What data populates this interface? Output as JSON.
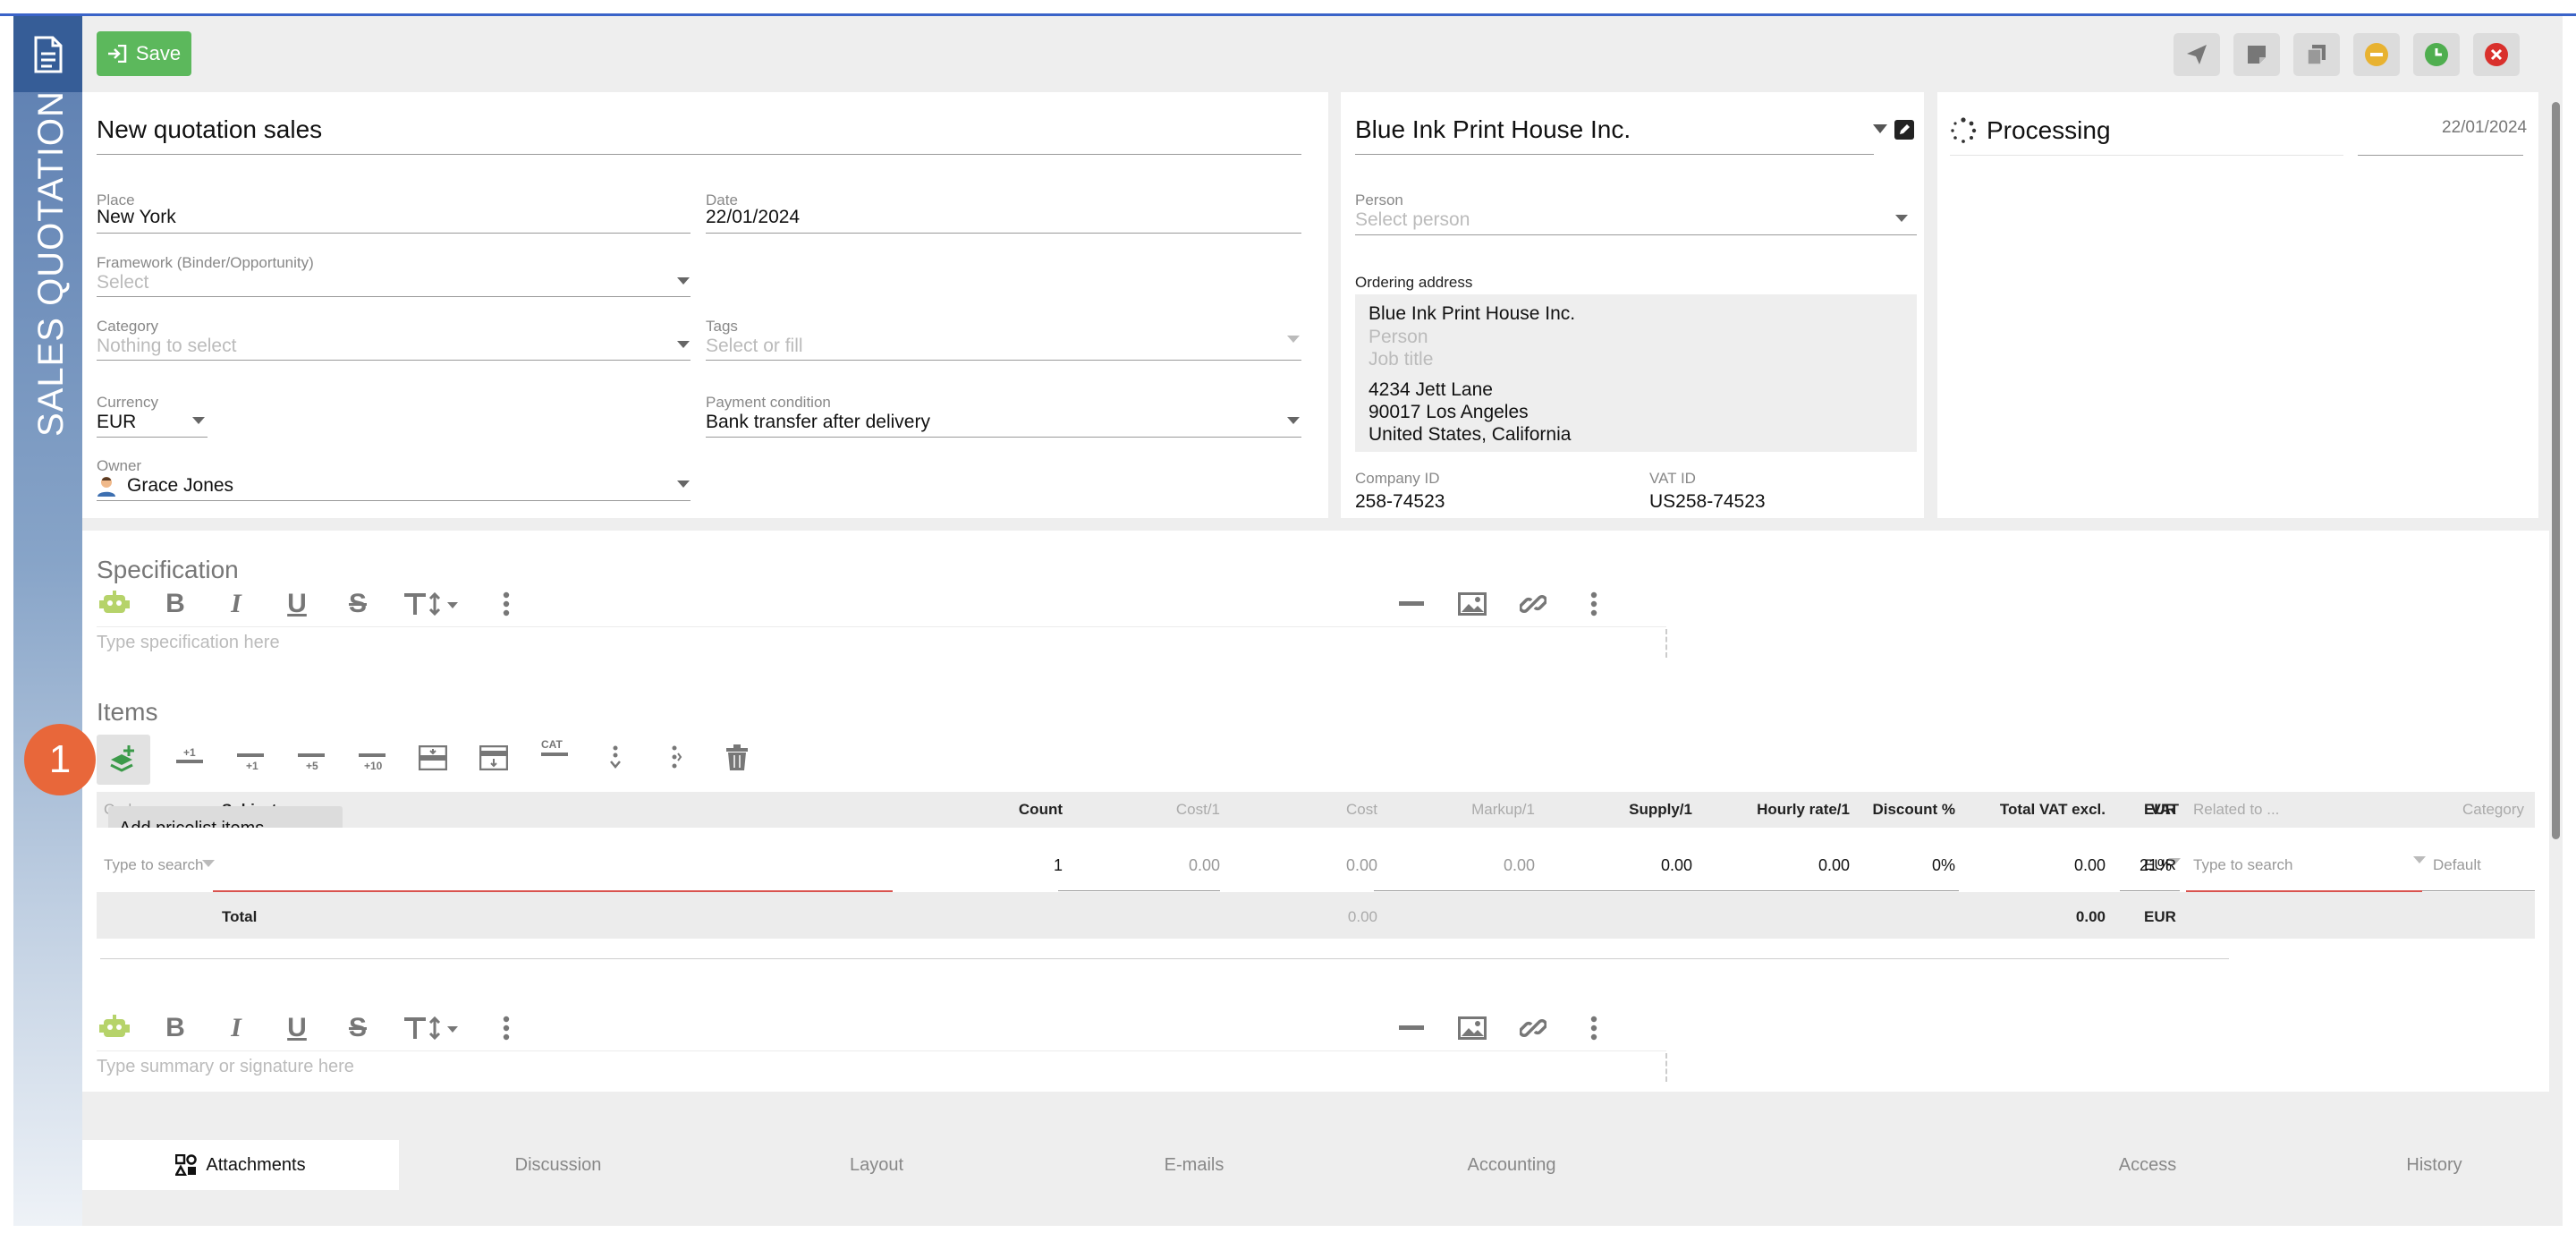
{
  "sidebar": {
    "title": "SALES QUOTATION"
  },
  "toolbar": {
    "save_label": "Save"
  },
  "header": {
    "title": "New quotation sales",
    "place_label": "Place",
    "place_value": "New York",
    "date_label": "Date",
    "date_value": "22/01/2024",
    "framework_label": "Framework (Binder/Opportunity)",
    "framework_placeholder": "Select",
    "category_label": "Category",
    "category_placeholder": "Nothing to select",
    "tags_label": "Tags",
    "tags_placeholder": "Select or fill",
    "currency_label": "Currency",
    "currency_value": "EUR",
    "payment_label": "Payment condition",
    "payment_value": "Bank transfer after delivery",
    "owner_label": "Owner",
    "owner_value": "Grace Jones"
  },
  "customer": {
    "company": "Blue Ink Print House Inc.",
    "person_label": "Person",
    "person_placeholder": "Select person",
    "address_label": "Ordering address",
    "address_company": "Blue Ink Print House Inc.",
    "address_person_ph": "Person",
    "address_job_ph": "Job title",
    "address_street": "4234 Jett Lane",
    "address_city": "90017 Los Angeles",
    "address_country": "United States, California",
    "company_id_label": "Company ID",
    "company_id_value": "258-74523",
    "vat_id_label": "VAT ID",
    "vat_id_value": "US258-74523"
  },
  "status": {
    "label": "Processing",
    "date": "22/01/2024"
  },
  "specification": {
    "title": "Specification",
    "placeholder": "Type specification here"
  },
  "items": {
    "title": "Items",
    "badge": "1",
    "tool_labels": {
      "plus1": "+1",
      "plus5": "+5",
      "plus10": "+10",
      "cat": "CAT"
    },
    "tooltip": "Add pricelist items",
    "columns": {
      "code": "Code",
      "subject": "Subject",
      "count": "Count",
      "cost_unit": "Cost/1",
      "cost": "Cost",
      "markup": "Markup/1",
      "supply": "Supply/1",
      "hourly": "Hourly rate/1",
      "discount": "Discount %",
      "total_vat_excl": "Total VAT excl.",
      "vat": "VAT",
      "currency": "EUR",
      "related": "Related to ...",
      "category": "Category"
    },
    "row": {
      "code_placeholder": "Type to search",
      "count": "1",
      "cost_unit": "0.00",
      "cost": "0.00",
      "markup": "0.00",
      "supply": "0.00",
      "hourly": "0.00",
      "discount": "0%",
      "total": "0.00",
      "vat": "21%",
      "currency": "EUR",
      "related_placeholder": "Type to search",
      "category_placeholder": "Default"
    },
    "totals": {
      "label": "Total",
      "cost": "0.00",
      "total": "0.00",
      "currency": "EUR"
    }
  },
  "summary": {
    "placeholder": "Type summary or signature here"
  },
  "tabs": [
    "Attachments",
    "Discussion",
    "Layout",
    "E-mails",
    "Accounting",
    "Access",
    "History"
  ]
}
